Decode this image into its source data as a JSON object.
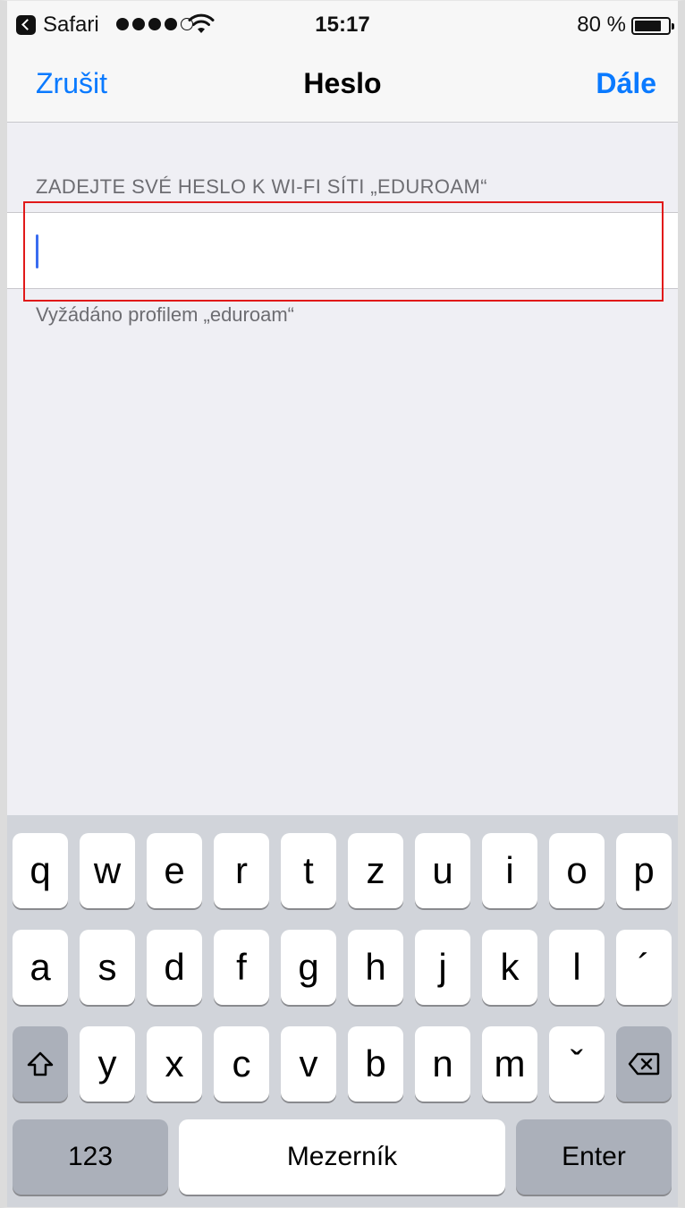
{
  "status_bar": {
    "app": "Safari",
    "time": "15:17",
    "battery": "80 %",
    "battery_level": 0.8,
    "signal_bars": 4
  },
  "nav": {
    "cancel": "Zrušit",
    "title": "Heslo",
    "next": "Dále"
  },
  "form": {
    "header": "ZADEJTE SVÉ HESLO K WI-FI SÍTI „EDUROAM“",
    "password_value": "",
    "footer": "Vyžádáno profilem „eduroam“"
  },
  "colors": {
    "accent": "#0a7aff",
    "highlight": "#e11919",
    "caret": "#3a6cf0"
  },
  "keyboard": {
    "row1": [
      "q",
      "w",
      "e",
      "r",
      "t",
      "z",
      "u",
      "i",
      "o",
      "p"
    ],
    "row2": [
      "a",
      "s",
      "d",
      "f",
      "g",
      "h",
      "j",
      "k",
      "l",
      "´"
    ],
    "row3": [
      "y",
      "x",
      "c",
      "v",
      "b",
      "n",
      "m",
      "ˇ"
    ],
    "numbers": "123",
    "space": "Mezerník",
    "enter": "Enter",
    "shift_icon": "shift-icon",
    "delete_icon": "backspace-icon"
  }
}
